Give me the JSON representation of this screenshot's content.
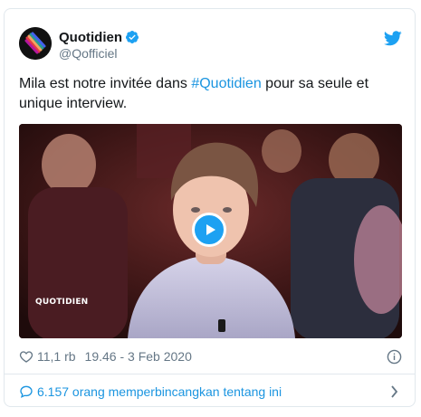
{
  "account": {
    "display_name": "Quotidien",
    "handle": "@Qofficiel",
    "verified": true
  },
  "tweet": {
    "text_before": "Mila est notre invitée dans ",
    "hashtag": "#Quotidien",
    "text_after": " pour sa seule et unique interview."
  },
  "media": {
    "type": "video",
    "watermark": "QUOTIDIEN"
  },
  "meta": {
    "likes": "11,1 rb",
    "timestamp": "19.46 - 3 Feb 2020"
  },
  "conversation": {
    "label": "6.157 orang memperbincangkan tentang ini"
  },
  "icons": {
    "platform": "twitter-bird-icon",
    "verified": "verified-badge-icon",
    "like": "heart-icon",
    "info": "info-icon",
    "reply": "reply-icon",
    "more": "chevron-right-icon",
    "play": "play-icon"
  },
  "colors": {
    "brand_blue": "#1da1f2",
    "link_blue": "#1b95e0",
    "text_primary": "#14171a",
    "text_secondary": "#657786",
    "border": "#e1e8ed"
  }
}
